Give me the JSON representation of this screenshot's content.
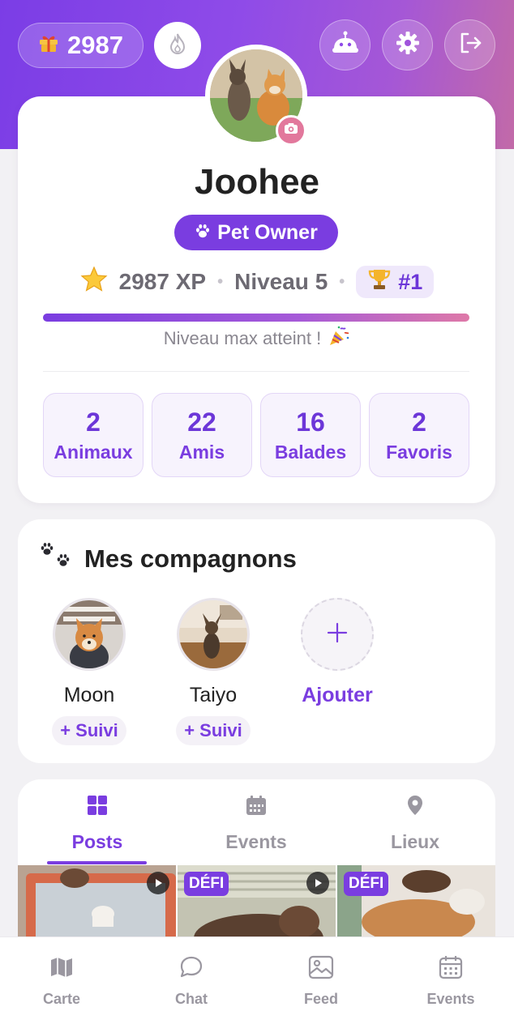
{
  "header": {
    "xp_points": "2987"
  },
  "profile": {
    "username": "Joohee",
    "role": "Pet Owner",
    "xp": "2987 XP",
    "level": "Niveau 5",
    "rank": "#1",
    "level_progress": 1.0,
    "progress_caption": "Niveau max atteint !",
    "stats": [
      {
        "value": "2",
        "label": "Animaux"
      },
      {
        "value": "22",
        "label": "Amis"
      },
      {
        "value": "16",
        "label": "Balades"
      },
      {
        "value": "2",
        "label": "Favoris"
      }
    ]
  },
  "companions": {
    "title": "Mes compagnons",
    "pets": [
      {
        "name": "Moon",
        "follow": "+ Suivi"
      },
      {
        "name": "Taiyo",
        "follow": "+ Suivi"
      }
    ],
    "add_label": "Ajouter"
  },
  "tabs": [
    {
      "label": "Posts",
      "icon": "grid-icon",
      "active": true
    },
    {
      "label": "Events",
      "icon": "calendar-icon",
      "active": false
    },
    {
      "label": "Lieux",
      "icon": "pin-icon",
      "active": false
    }
  ],
  "posts": [
    {
      "badge": "",
      "video": true
    },
    {
      "badge": "DÉFI",
      "video": true
    },
    {
      "badge": "DÉFI",
      "video": false
    }
  ],
  "bottom_nav": [
    {
      "label": "Carte",
      "icon": "map-icon"
    },
    {
      "label": "Chat",
      "icon": "chat-icon"
    },
    {
      "label": "Feed",
      "icon": "image-icon"
    },
    {
      "label": "Events",
      "icon": "calendar-icon"
    }
  ],
  "colors": {
    "accent": "#7a3de0",
    "gradient_start": "#7b3de6",
    "gradient_end": "#c26aa8",
    "camera_badge": "#e2789c"
  }
}
